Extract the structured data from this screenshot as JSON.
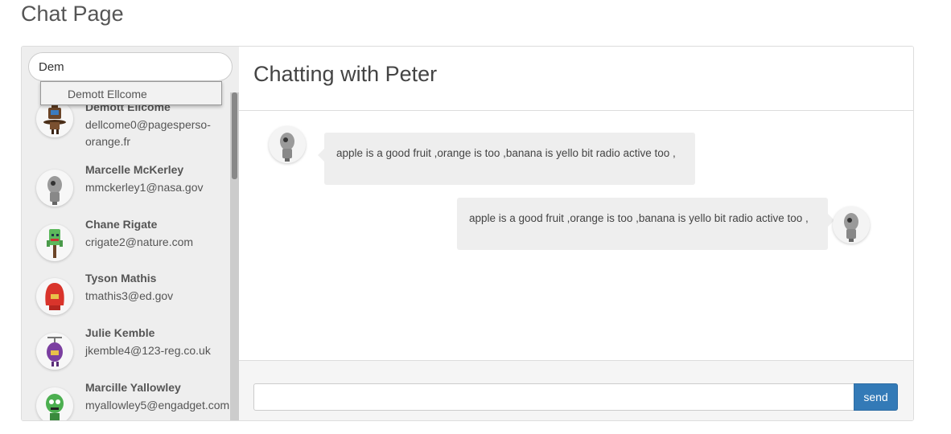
{
  "page": {
    "title": "Chat Page"
  },
  "search": {
    "value": "Dem",
    "placeholder": ""
  },
  "autocomplete": {
    "items": [
      "Demott Ellcome"
    ]
  },
  "contacts": [
    {
      "name": "Demott Ellcome",
      "email": "dellcome0@pagesperso-orange.fr",
      "avatar_icon": "brown-hat-robot-icon"
    },
    {
      "name": "Marcelle McKerley",
      "email": "mmckerley1@nasa.gov",
      "avatar_icon": "gray-robot-icon"
    },
    {
      "name": "Chane Rigate",
      "email": "crigate2@nature.com",
      "avatar_icon": "green-block-robot-icon"
    },
    {
      "name": "Tyson Mathis",
      "email": "tmathis3@ed.gov",
      "avatar_icon": "red-hood-robot-icon"
    },
    {
      "name": "Julie Kemble",
      "email": "jkemble4@123-reg.co.uk",
      "avatar_icon": "purple-propeller-robot-icon"
    },
    {
      "name": "Marcille Yallowley",
      "email": "myallowley5@engadget.com",
      "avatar_icon": "green-alien-robot-icon"
    }
  ],
  "chat": {
    "title": "Chatting with Peter",
    "messages": [
      {
        "direction": "incoming",
        "text": "apple is a good fruit ,orange is too ,banana is yello bit radio active too ,"
      },
      {
        "direction": "outgoing",
        "text": "apple is a good fruit ,orange is too ,banana is yello bit radio active too ,"
      }
    ]
  },
  "composer": {
    "value": "",
    "placeholder": "",
    "send_label": "send"
  },
  "colors": {
    "accent": "#337ab7",
    "sidebar_bg": "#eeeeee",
    "bubble_bg": "#eeeeee"
  }
}
